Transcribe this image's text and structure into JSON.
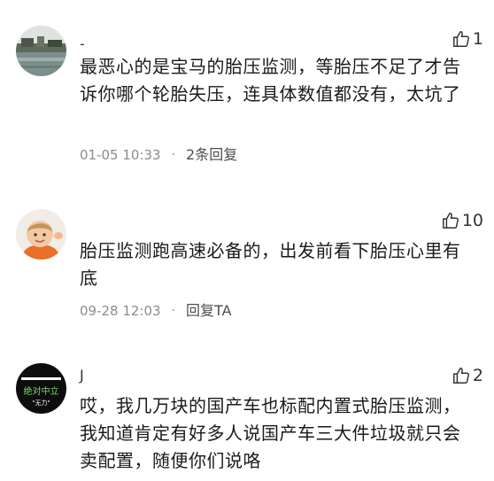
{
  "comments": [
    {
      "username": "-",
      "likes": "1",
      "content": "最恶心的是宝马的胎压监测，等胎压不足了才告诉你哪个轮胎失压，连具体数值都没有，太坑了",
      "time": "01-05 10:33",
      "reply": "2条回复"
    },
    {
      "username": "",
      "likes": "10",
      "content": "胎压监测跑高速必备的，出发前看下胎压心里有底",
      "time": "09-28 12:03",
      "reply": "回复TA"
    },
    {
      "username": "J",
      "likes": "2",
      "content": "哎，我几万块的国产车也标配内置式胎压监测，我知道肯定有好多人说国产车三大件垃圾就只会卖配置，随便你们说咯",
      "avatar_text_top": "绝对中立",
      "avatar_text_bottom": "\"无力\""
    }
  ]
}
